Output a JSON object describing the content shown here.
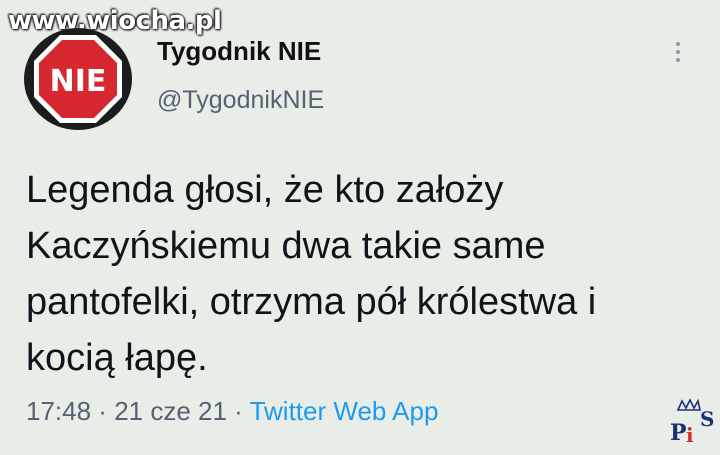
{
  "watermark": "www.wiocha.pl",
  "author": {
    "avatar_text": "NIE",
    "display_name": "Tygodnik NIE",
    "handle": "@TygodnikNIE",
    "avatar_icon": "stop-sign-icon"
  },
  "tweet": {
    "lines": [
      "Legenda głosi, że kto założy",
      "Kaczyńskiemu dwa takie same",
      "pantofelki, otrzyma pół królestwa i",
      "kocią łapę."
    ]
  },
  "meta": {
    "time": "17:48",
    "separator": " · ",
    "date": "21 cze 21",
    "source": "Twitter Web App"
  },
  "logo": {
    "letters": [
      "P",
      "i",
      "S"
    ]
  },
  "colors": {
    "background": "#e9ede8",
    "link": "#1d9bf0",
    "stop_sign": "#d7282f"
  },
  "icons": {
    "more": "more-vertical-icon"
  }
}
